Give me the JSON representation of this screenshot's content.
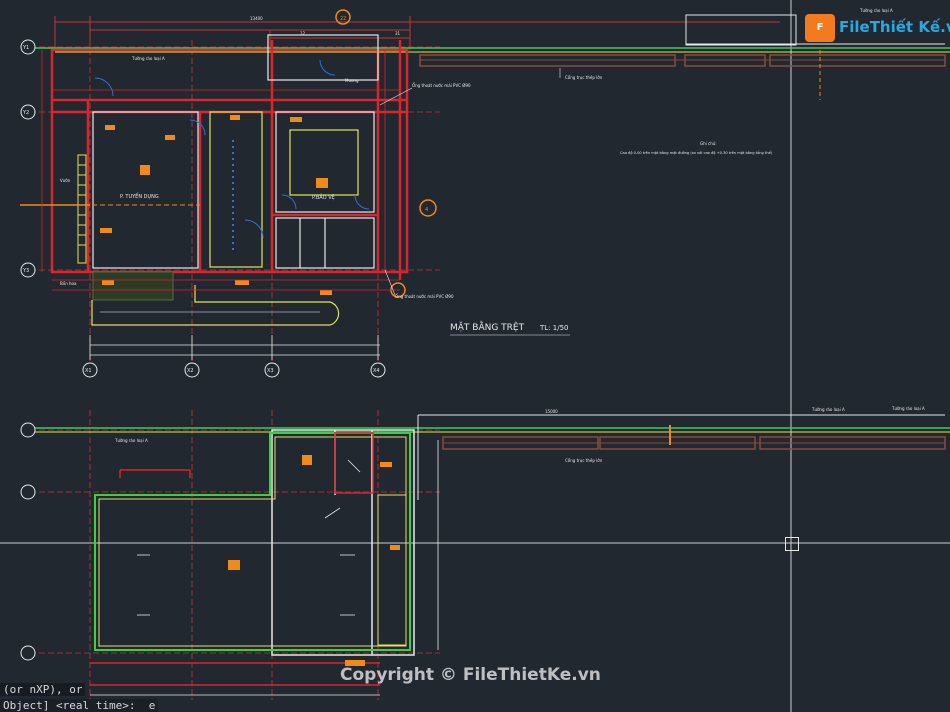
{
  "app": {
    "command_line": [
      "(or nXP), or",
      "Object] <real time>:  e"
    ]
  },
  "watermark": {
    "logo_text": "FileThiết Kế.vn",
    "copyright": "Copyright © FileThietKe.vn"
  },
  "drawing": {
    "title": "MẶT BẰNG TRỆT",
    "scale": "TL: 1/50",
    "rooms": [
      "P. TUYỂN DỤNG",
      "P.BẢO VỆ"
    ],
    "notes": [
      "Ống thoát nước mái PVC Ø90",
      "Ống thoát nước mái PVC Ø90",
      "Cổng trục thép lớn",
      "Tường rào loại A",
      "Tường rào loại A",
      "Ghi chú:",
      "Cao độ 0.00 trên mặt bằng mặt đường (so với cao độ +0.30 trên mặt bằng tổng thể)",
      "Cổng trục thép lớn",
      "Bồn hoa",
      "Mương",
      "Vườn",
      "Tường rào loại A",
      "Tường rào loại A",
      "Tường rào loại A"
    ],
    "axis_labels_top": [
      "12",
      "22",
      "31",
      "4"
    ],
    "axis_labels_left": [
      "Y1",
      "Y2",
      "Y3"
    ],
    "axis_labels_bottom": [
      "X1",
      "X2",
      "X3",
      "X4"
    ],
    "dimension_top": "13400",
    "dimension_total": "15000"
  },
  "colors": {
    "background": "#212830",
    "wall_red": "#d9252b",
    "dim_red": "#c8323a",
    "wall_white": "#e8e8e8",
    "green": "#35d14a",
    "yellow": "#e2e25a",
    "orange": "#f08a1a",
    "blue": "#3b6ad6",
    "gray": "#8a8f96",
    "brown": "#8a4a3a"
  }
}
